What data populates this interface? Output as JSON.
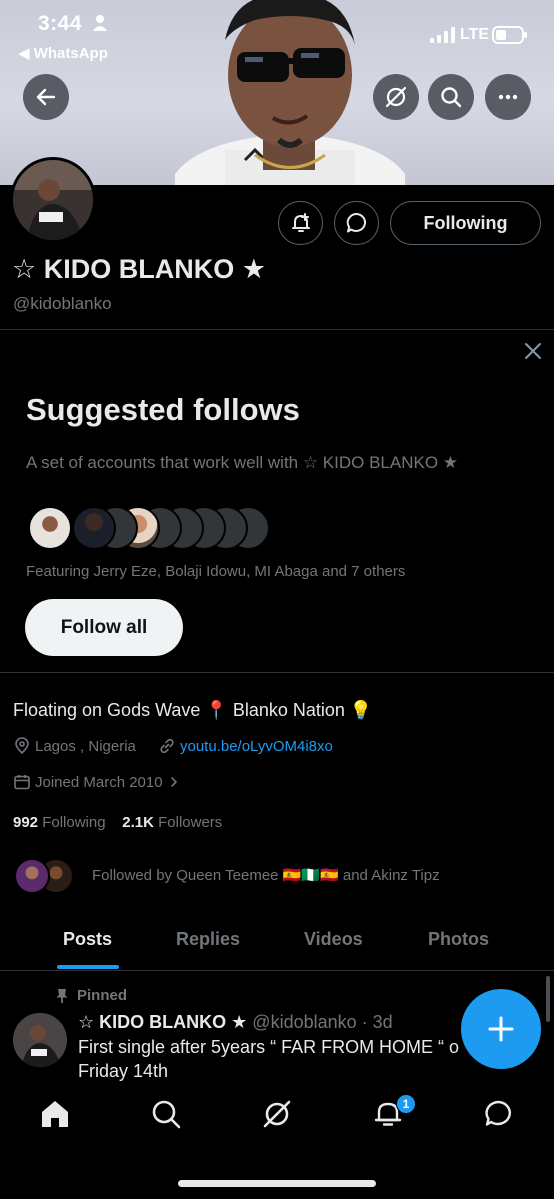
{
  "status_bar": {
    "time": "3:44",
    "back_app": "◀ WhatsApp",
    "network": "LTE"
  },
  "profile": {
    "name": "☆ KIDO BLANKO ★",
    "handle": "@kidoblanko",
    "following_button": "Following",
    "bio": "Floating on Gods Wave 📍 Blanko Nation 💡",
    "location": "Lagos , Nigeria",
    "website": "youtu.be/oLyvOM4i8xo",
    "joined": "Joined March 2010",
    "following_count": "992",
    "following_label": "Following",
    "followers_count": "2.1K",
    "followers_label": "Followers",
    "followed_by": "Followed by Queen Teemee 🇪🇸🇳🇬🇪🇸 and Akinz Tipz"
  },
  "suggested": {
    "title": "Suggested follows",
    "subtitle": "A set of accounts that work well with ☆ KIDO BLANKO ★",
    "featuring": "Featuring Jerry Eze, Bolaji Idowu, MI Abaga and 7 others",
    "follow_all": "Follow all"
  },
  "tabs": [
    {
      "label": "Posts",
      "active": true
    },
    {
      "label": "Replies",
      "active": false
    },
    {
      "label": "Videos",
      "active": false
    },
    {
      "label": "Photos",
      "active": false
    }
  ],
  "post": {
    "pinned_label": "Pinned",
    "author": "☆ KIDO BLANKO ★",
    "meta": "@kidoblanko · 3d",
    "line1": "First single after 5years “ FAR FROM HOME “ o",
    "line2": "Friday 14th"
  },
  "bottom_nav": {
    "notification_badge": "1"
  },
  "colors": {
    "accent": "#1d9bf0",
    "background": "#000000",
    "text_primary": "#e7e9ea",
    "text_secondary": "#71767b"
  }
}
